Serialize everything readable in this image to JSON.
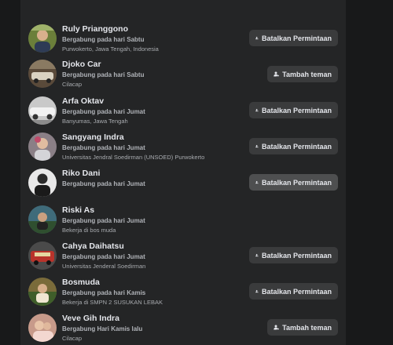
{
  "people": [
    {
      "name": "Ruly Prianggono",
      "joined": "Bergabung pada hari Sabtu",
      "detail": "Purwokerto, Jawa Tengah, Indonesia",
      "action": "Batalkan Permintaan",
      "action_type": "cancel",
      "avatar_color": "#6b7f3a"
    },
    {
      "name": "Djoko Car",
      "joined": "Bergabung pada hari Sabtu",
      "detail": "Cilacap",
      "action": "Tambah teman",
      "action_type": "add",
      "avatar_color": "#5a4a3a"
    },
    {
      "name": "Arfa Oktav",
      "joined": "Bergabung pada hari Jumat",
      "detail": "Banyumas, Jawa Tengah",
      "action": "Batalkan Permintaan",
      "action_type": "cancel",
      "avatar_color": "#c9c9c9"
    },
    {
      "name": "Sangyang Indra",
      "joined": "Bergabung pada hari Jumat",
      "detail": "Universitas Jendral Soedirman (UNSOED) Purwokerto",
      "action": "Batalkan Permintaan",
      "action_type": "cancel",
      "avatar_color": "#8a7f86"
    },
    {
      "name": "Riko Dani",
      "joined": "Bergabung pada hari Jumat",
      "detail": "",
      "action": "Batalkan Permintaan",
      "action_type": "cancel",
      "avatar_color": "#e8e8e8"
    },
    {
      "name": "Riski As",
      "joined": "Bergabung pada hari Jumat",
      "detail": "Bekerja di bos muda",
      "action": "",
      "action_type": "none",
      "avatar_color": "#3f6b7a"
    },
    {
      "name": "Cahya Daihatsu",
      "joined": "Bergabung pada hari Jumat",
      "detail": "Universitas Jenderal Soedirman",
      "action": "Batalkan Permintaan",
      "action_type": "cancel",
      "avatar_color": "#b8332b"
    },
    {
      "name": "Bosmuda",
      "joined": "Bergabung pada hari Kamis",
      "detail": "Bekerja di SMPN 2 SUSUKAN LEBAK",
      "action": "Batalkan Permintaan",
      "action_type": "cancel",
      "avatar_color": "#7a6b3a"
    },
    {
      "name": "Veve Gih Indra",
      "joined": "Bergabung Hari Kamis lalu",
      "detail": "Cilacap",
      "action": "Tambah teman",
      "action_type": "add",
      "avatar_color": "#c79a8a"
    }
  ],
  "icons": {
    "cancel": "person-cancel-icon",
    "add": "person-add-icon"
  },
  "colors": {
    "page_bg": "#18191a",
    "panel_bg": "#242526",
    "button_bg": "#3a3b3c",
    "text_primary": "#e4e6eb",
    "text_secondary": "#b0b3b8"
  }
}
